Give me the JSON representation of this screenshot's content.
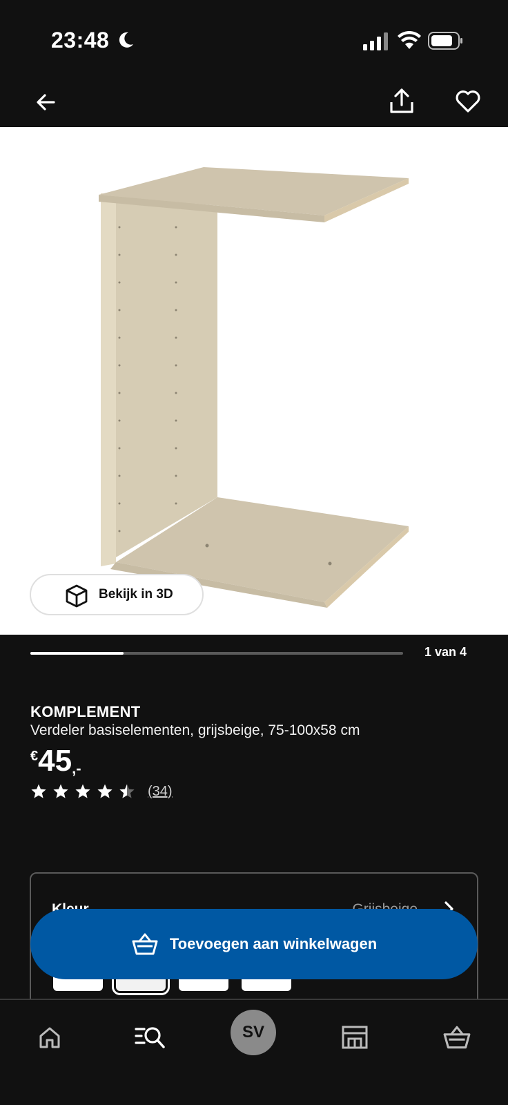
{
  "status_bar": {
    "time": "23:48"
  },
  "icons": {
    "back": "arrow-left-icon",
    "share": "share-icon",
    "favorite": "heart-icon",
    "view3d": "cube-icon",
    "cart": "shopping-basket-icon",
    "tabs": [
      "home-icon",
      "search-list-icon",
      "avatar",
      "store-icon",
      "cart-icon"
    ]
  },
  "viewer": {
    "view3d_label": "Bekijk in 3D"
  },
  "carousel": {
    "counter": "1 van 4",
    "current": 1,
    "total": 4
  },
  "product": {
    "brand": "KOMPLEMENT",
    "description": "Verdeler basiselementen, grijsbeige, 75-100x58 cm",
    "price_currency": "€",
    "price_integer": "45",
    "price_decimal": ",-",
    "rating": 4.5,
    "rating_count": "(34)"
  },
  "color_selector": {
    "label": "Kleur",
    "value": "Grijsbeige"
  },
  "cart_button": {
    "label": "Toevoegen aan winkelwagen"
  },
  "tabbar": {
    "avatar_initials": "SV"
  },
  "colors": {
    "background": "#111111",
    "accent": "#0058a3",
    "image_bg": "#ffffff"
  }
}
